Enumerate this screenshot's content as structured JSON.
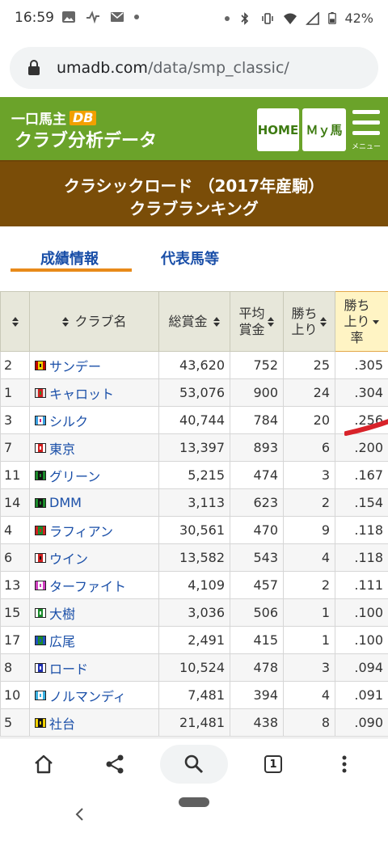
{
  "status": {
    "time": "16:59",
    "battery": "42%"
  },
  "browser": {
    "url_host": "umadb.com",
    "url_path": "/data/smp_classic/"
  },
  "header": {
    "logo_top": "一口馬主",
    "logo_db": "DB",
    "logo_bottom": "クラブ分析データ",
    "home_label": "HOME",
    "my_label": "Ｍｙ馬",
    "menu_label": "メニュー",
    "brand_green": "#6ba32a",
    "brand_brown": "#7a4d08"
  },
  "title": {
    "line1": "クラシックロード （2017年産駒）",
    "line2": "クラブランキング"
  },
  "tabs": [
    {
      "label": "成績情報",
      "active": true
    },
    {
      "label": "代表馬等",
      "active": false
    }
  ],
  "table": {
    "headers": {
      "club": "クラブ名",
      "prize": "総賞金",
      "avg_a": "平均",
      "avg_b": "賞金",
      "wins_a": "勝ち",
      "wins_b": "上り",
      "rate_a": "勝ち",
      "rate_b": "上り",
      "rate_c": "率"
    },
    "rows": [
      {
        "rank": "2",
        "club": "サンデー",
        "prize": "43,620",
        "avg": "752",
        "wins": "25",
        "rate": ".305",
        "silk": [
          "#c00000",
          "#f0d000",
          "#111111"
        ]
      },
      {
        "rank": "1",
        "club": "キャロット",
        "prize": "53,076",
        "avg": "900",
        "wins": "24",
        "rate": ".304",
        "silk": [
          "#e0e0e0",
          "#d02020",
          "#2a8a2a"
        ]
      },
      {
        "rank": "3",
        "club": "シルク",
        "prize": "40,744",
        "avg": "784",
        "wins": "20",
        "rate": ".256",
        "silk": [
          "#3aa0e0",
          "#ffffff",
          "#d02080"
        ]
      },
      {
        "rank": "7",
        "club": "東京",
        "prize": "13,397",
        "avg": "893",
        "wins": "6",
        "rate": ".200",
        "silk": [
          "#ffffff",
          "#d02020",
          "#ffffff"
        ]
      },
      {
        "rank": "11",
        "club": "グリーン",
        "prize": "5,215",
        "avg": "474",
        "wins": "3",
        "rate": ".167",
        "silk": [
          "#1a8a2a",
          "#111111",
          "#1a8a2a"
        ]
      },
      {
        "rank": "14",
        "club": "DMM",
        "prize": "3,113",
        "avg": "623",
        "wins": "2",
        "rate": ".154",
        "silk": [
          "#1a8a2a",
          "#111111",
          "#1a8a2a"
        ]
      },
      {
        "rank": "4",
        "club": "ラフィアン",
        "prize": "30,561",
        "avg": "470",
        "wins": "9",
        "rate": ".118",
        "silk": [
          "#d02020",
          "#1a8a2a",
          "#d02020"
        ]
      },
      {
        "rank": "6",
        "club": "ウイン",
        "prize": "13,582",
        "avg": "543",
        "wins": "4",
        "rate": ".118",
        "silk": [
          "#ffffff",
          "#d02020",
          "#111111"
        ]
      },
      {
        "rank": "13",
        "club": "ターファイト",
        "prize": "4,109",
        "avg": "457",
        "wins": "2",
        "rate": ".111",
        "silk": [
          "#d040c0",
          "#ffffff",
          "#d040c0"
        ]
      },
      {
        "rank": "15",
        "club": "大樹",
        "prize": "3,036",
        "avg": "506",
        "wins": "1",
        "rate": ".100",
        "silk": [
          "#ffffff",
          "#1a8a2a",
          "#ffffff"
        ]
      },
      {
        "rank": "17",
        "club": "広尾",
        "prize": "2,491",
        "avg": "415",
        "wins": "1",
        "rate": ".100",
        "silk": [
          "#2050c0",
          "#1a8a2a",
          "#2050c0"
        ]
      },
      {
        "rank": "8",
        "club": "ロード",
        "prize": "10,524",
        "avg": "478",
        "wins": "3",
        "rate": ".094",
        "silk": [
          "#ffffff",
          "#2030b0",
          "#ffffff"
        ]
      },
      {
        "rank": "10",
        "club": "ノルマンディ",
        "prize": "7,481",
        "avg": "394",
        "wins": "4",
        "rate": ".091",
        "silk": [
          "#3ab0e0",
          "#ffffff",
          "#3ab0e0"
        ]
      },
      {
        "rank": "5",
        "club": "社台",
        "prize": "21,481",
        "avg": "438",
        "wins": "8",
        "rate": ".090",
        "silk": [
          "#f0d000",
          "#111111",
          "#f0d000"
        ]
      }
    ]
  },
  "bottom_bar": {
    "tab_count": "1"
  }
}
